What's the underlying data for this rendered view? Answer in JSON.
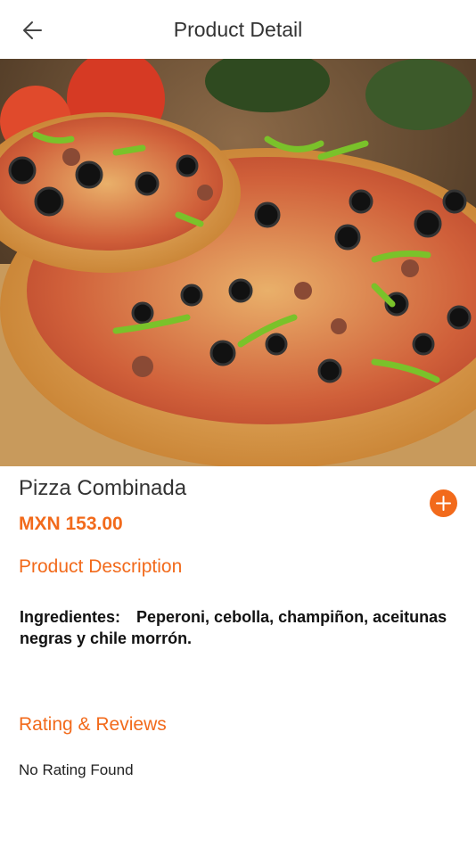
{
  "header": {
    "title": "Product Detail",
    "back_icon": "arrow-left-icon"
  },
  "product": {
    "name": "Pizza Combinada",
    "price": "MXN 153.00",
    "image_alt": "pizza-photo",
    "add_icon": "plus-icon"
  },
  "description": {
    "heading": "Product Description",
    "label": "Ingredientes:",
    "text": "Peperoni, cebolla, champiñon, aceitunas negras y chile morrón."
  },
  "reviews": {
    "heading": "Rating & Reviews",
    "empty_text": "No Rating Found"
  },
  "colors": {
    "accent": "#f26a1b",
    "text": "#333333"
  }
}
